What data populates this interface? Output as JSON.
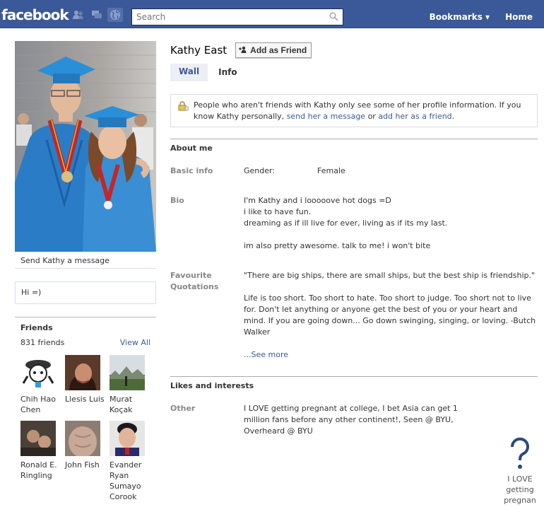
{
  "topbar": {
    "logo": "facebook",
    "search_placeholder": "Search",
    "bookmarks": "Bookmarks ▾",
    "home": "Home"
  },
  "left": {
    "send_message": "Send Kathy a message",
    "status": "Hi =)",
    "friends_title": "Friends",
    "friends_count": "831 friends",
    "view_all": "View All",
    "friends": [
      {
        "name": "Chih Hao Chen"
      },
      {
        "name": "Llesis Luis"
      },
      {
        "name": "Murat Koçak"
      },
      {
        "name": "Ronald E. Ringling"
      },
      {
        "name": "John Fish"
      },
      {
        "name": "Evander Ryan Sumayo Corook"
      }
    ]
  },
  "main": {
    "name": "Kathy East",
    "add_friend": "Add as Friend",
    "tabs": [
      "Wall",
      "Info"
    ],
    "notice_prefix": "People who aren't friends with Kathy only see some of her profile information. If you know Kathy personally, ",
    "notice_link1": "send her a message",
    "notice_mid": " or ",
    "notice_link2": "add her as a friend",
    "notice_suffix": ".",
    "about_title": "About me",
    "basic_info_label": "Basic info",
    "gender_key": "Gender:",
    "gender_value": "Female",
    "bio_label": "Bio",
    "bio_lines": [
      "I'm Kathy and i looooove hot dogs =D",
      "i like to have fun.",
      "dreaming as if ill live for ever, living as if its my last.",
      "",
      "im also pretty awesome. talk to me! i won't bite"
    ],
    "quotes_label": "Favourite Quotations",
    "quote1": "\"There are big ships, there are small ships, but the best ship is friendship.\"",
    "quote2": "Life is too short. Too short to hate. Too short to judge. Too short not to live for. Don't let anything or anyone get the best of you or your heart and mind. If you are going down... Go down swinging, singing, or loving. -Butch Walker",
    "see_more": "...See more",
    "likes_title": "Likes and interests",
    "other_label": "Other",
    "other_value": "I LOVE getting pregnant at college, I bet Asia can get 1 million fans before any other continent!, Seen @ BYU, Overheard @ BYU"
  },
  "side_ad": {
    "caption": "I LOVE getting pregnan"
  },
  "colors": {
    "brand": "#3b5998",
    "gown": "#2a7cc7"
  }
}
